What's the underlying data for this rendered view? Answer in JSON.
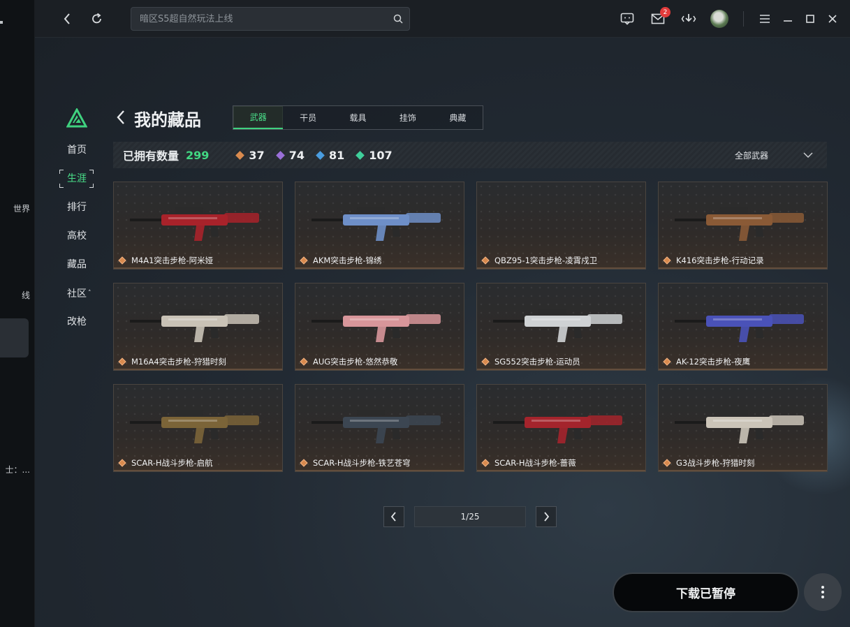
{
  "launcher": {
    "fragments": [
      "世界",
      "线",
      "士：..."
    ]
  },
  "topbar": {
    "search_placeholder": "暗区S5超自然玩法上线",
    "mail_badge": "2",
    "icons": [
      "back-icon",
      "refresh-icon",
      "search-icon",
      "chat-icon",
      "mail-icon",
      "download-icon",
      "avatar",
      "menu-icon",
      "minimize-icon",
      "maximize-icon",
      "close-icon"
    ]
  },
  "game_nav": {
    "items": [
      {
        "label": "首页"
      },
      {
        "label": "生涯"
      },
      {
        "label": "排行"
      },
      {
        "label": "高校"
      },
      {
        "label": "藏品"
      },
      {
        "label": "社区"
      },
      {
        "label": "改枪"
      }
    ],
    "active_index": 1
  },
  "page": {
    "title": "我的藏品"
  },
  "tabs": [
    {
      "label": "武器"
    },
    {
      "label": "干员"
    },
    {
      "label": "载具"
    },
    {
      "label": "挂饰"
    },
    {
      "label": "典藏"
    }
  ],
  "stats": {
    "owned_label": "已拥有数量",
    "owned_count": "299",
    "rarities": [
      {
        "value": "37",
        "color": "#d98a4e"
      },
      {
        "value": "74",
        "color": "#9a6fd8"
      },
      {
        "value": "81",
        "color": "#4a9de0"
      },
      {
        "value": "107",
        "color": "#3fcf9a"
      }
    ],
    "filter_label": "全部武器"
  },
  "items": [
    {
      "name": "M4A1突击步枪-阿米娅",
      "tone": "#a8222a"
    },
    {
      "name": "AKM突击步枪-锦绣",
      "tone": "#6e8fc8"
    },
    {
      "name": "QBZ95-1突击步枪-凌霄戍卫",
      "tone": ""
    },
    {
      "name": "K416突击步枪-行动记录",
      "tone": "#8a5a36"
    },
    {
      "name": "M16A4突击步枪-狩猎时刻",
      "tone": "#c9c2b6"
    },
    {
      "name": "AUG突击步枪-悠然恭敬",
      "tone": "#d8969a"
    },
    {
      "name": "SG552突击步枪-运动员",
      "tone": "#cfd2d4"
    },
    {
      "name": "AK-12突击步枪-夜鹰",
      "tone": "#4a52b8"
    },
    {
      "name": "SCAR-H战斗步枪-启航",
      "tone": "#7b6438"
    },
    {
      "name": "SCAR-H战斗步枪-铁艺苍穹",
      "tone": "#3c4652"
    },
    {
      "name": "SCAR-H战斗步枪-蔷薇",
      "tone": "#a4242c"
    },
    {
      "name": "G3战斗步枪-狩猎时刻",
      "tone": "#cbc4b8"
    }
  ],
  "pagination": {
    "current": "1/25"
  },
  "download": {
    "label": "下载已暂停"
  }
}
